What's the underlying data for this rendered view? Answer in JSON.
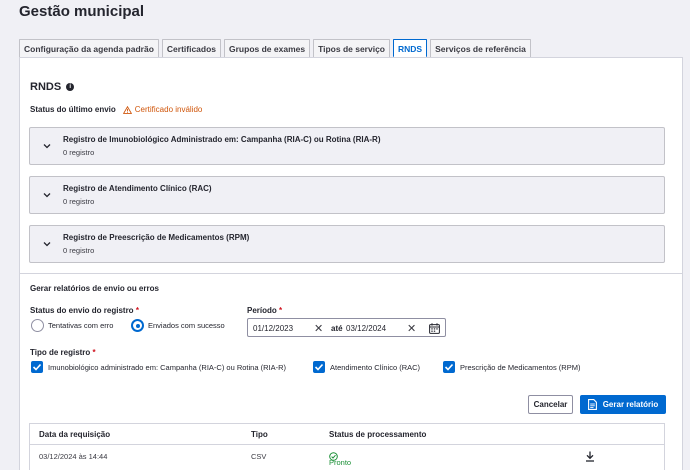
{
  "page": {
    "title": "Gestão municipal"
  },
  "tabs": [
    {
      "label": "Configuração da agenda padrão",
      "active": false
    },
    {
      "label": "Certificados",
      "active": false
    },
    {
      "label": "Grupos de exames",
      "active": false
    },
    {
      "label": "Tipos de serviço",
      "active": false
    },
    {
      "label": "RNDS",
      "active": true
    },
    {
      "label": "Serviços de referência",
      "active": false
    }
  ],
  "rnds": {
    "title": "RNDS",
    "status_label": "Status do último envio",
    "status_value": "Certificado inválido"
  },
  "accordions": [
    {
      "title": "Registro de Imunobiológico Administrado em: Campanha (RIA-C) ou Rotina (RIA-R)",
      "count": "0 registro"
    },
    {
      "title": "Registro de Atendimento Clínico (RAC)",
      "count": "0 registro"
    },
    {
      "title": "Registro de Preescrição de Medicamentos (RPM)",
      "count": "0 registro"
    }
  ],
  "report": {
    "title": "Gerar relatórios de envio ou erros",
    "status_label": "Status do envio do registro",
    "status_options": [
      {
        "label": "Tentativas com erro",
        "selected": false
      },
      {
        "label": "Enviados com sucesso",
        "selected": true
      }
    ],
    "period_label": "Período",
    "period_start": "01/12/2023",
    "period_sep": "até",
    "period_end": "03/12/2024",
    "required_mark": "*",
    "type_label": "Tipo de registro",
    "type_options": [
      {
        "label": "Imunobiológico administrado em: Campanha (RIA-C) ou Rotina (RIA-R)",
        "checked": true
      },
      {
        "label": "Atendimento Clínico (RAC)",
        "checked": true
      },
      {
        "label": "Prescrição de Medicamentos (RPM)",
        "checked": true
      }
    ],
    "cancel_label": "Cancelar",
    "generate_label": "Gerar relatório"
  },
  "table": {
    "columns": [
      "Data da requisição",
      "Tipo",
      "Status de processamento"
    ],
    "rows": [
      {
        "date": "03/12/2024 às 14:44",
        "type": "CSV",
        "status": "Pronto"
      }
    ]
  },
  "colors": {
    "primary": "#0069d0",
    "warning": "#d0560b",
    "success": "#1a8f36",
    "required": "#d0131f"
  }
}
